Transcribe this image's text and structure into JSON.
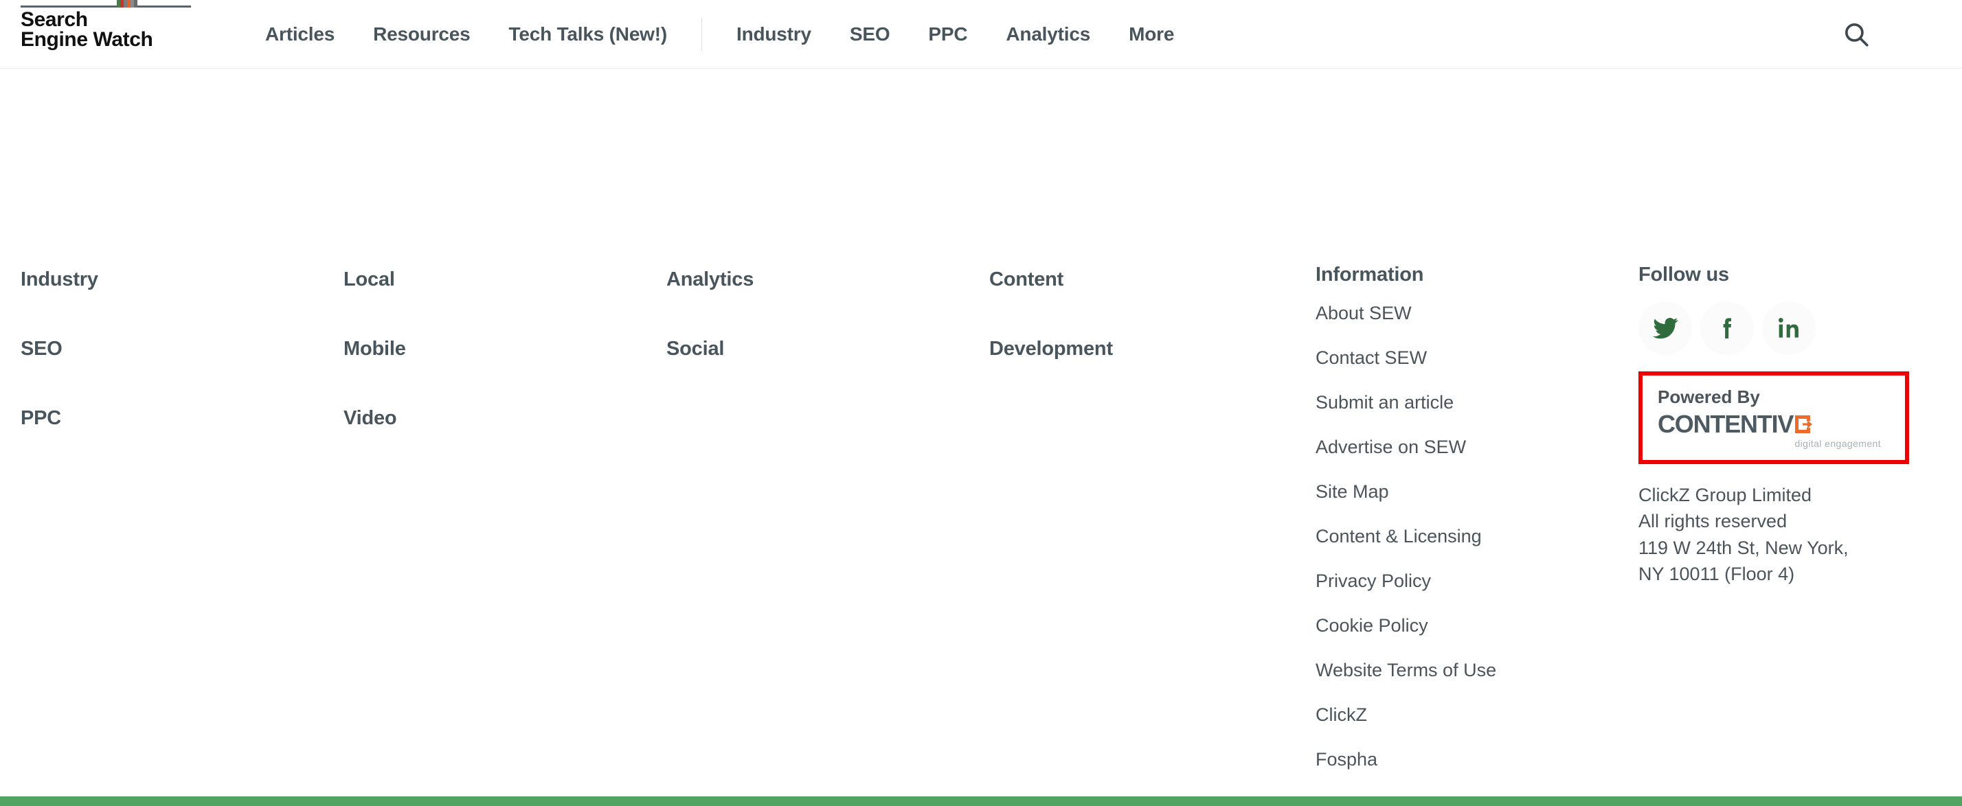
{
  "top_bleed": {
    "center_text": "Content",
    "left_hint": "",
    "right_hint": ""
  },
  "header": {
    "logo": {
      "line1": "Search",
      "line2": "Engine Watch",
      "swatch_colors": [
        "#4c7a4c",
        "#c8352c",
        "#7d7d7d",
        "#e4632a",
        "#8a8a8a",
        "#6b6b6b"
      ]
    },
    "nav_primary": [
      {
        "label": "Articles"
      },
      {
        "label": "Resources"
      },
      {
        "label": "Tech Talks (New!)"
      }
    ],
    "nav_secondary": [
      {
        "label": "Industry"
      },
      {
        "label": "SEO"
      },
      {
        "label": "PPC"
      },
      {
        "label": "Analytics"
      },
      {
        "label": "More"
      }
    ],
    "search_icon": "search-icon",
    "menu_icon": "hamburger-menu-icon"
  },
  "footer": {
    "columns": [
      {
        "name": "industry",
        "items": [
          "Industry",
          "SEO",
          "PPC"
        ]
      },
      {
        "name": "local",
        "items": [
          "Local",
          "Mobile",
          "Video"
        ]
      },
      {
        "name": "analytics",
        "items": [
          "Analytics",
          "Social"
        ]
      },
      {
        "name": "content",
        "items": [
          "Content",
          "Development"
        ]
      }
    ],
    "information": {
      "heading": "Information",
      "links": [
        "About SEW",
        "Contact SEW",
        "Submit an article",
        "Advertise on SEW",
        "Site Map",
        "Content & Licensing",
        "Privacy Policy",
        "Cookie Policy",
        "Website Terms of Use",
        "ClickZ",
        "Fospha"
      ]
    },
    "follow": {
      "heading": "Follow us",
      "socials": [
        {
          "name": "twitter",
          "label": "Twitter"
        },
        {
          "name": "facebook",
          "label": "Facebook"
        },
        {
          "name": "linkedin",
          "label": "LinkedIn"
        }
      ]
    },
    "powered_by": {
      "label": "Powered By",
      "brand": "CONTENTIV",
      "tagline": "digital engagement",
      "highlight_color": "#ee0000",
      "brand_color": "#4d5a61",
      "mark_color": "#ef6b2b"
    },
    "address": {
      "line1": "ClickZ Group Limited",
      "line2": "All rights reserved",
      "line3": "119 W 24th St, New York,",
      "line4": "NY 10011 (Floor 4)"
    },
    "bottom_bar_color": "#52a462"
  },
  "colors": {
    "text": "#4a545a",
    "heading": "#49555c",
    "social_green": "#2f6b3c",
    "green_bar": "#52a462",
    "highlight_red": "#ee0000"
  }
}
